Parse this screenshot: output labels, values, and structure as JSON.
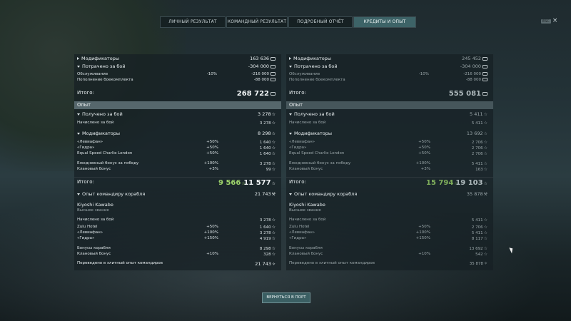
{
  "tabs": [
    "ЛИЧНЫЙ РЕЗУЛЬТАТ",
    "КОМАНДНЫЙ РЕЗУЛЬТАТ",
    "ПОДРОБНЫЙ ОТЧЁТ",
    "КРЕДИТЫ И ОПЫТ"
  ],
  "active_tab": 3,
  "close": {
    "esc_label": "ESC",
    "x": "×"
  },
  "left": {
    "modifiers": {
      "label": "Модификаторы",
      "value": "163 636"
    },
    "spent": {
      "label": "Потрачено за бой",
      "value": "-304 000"
    },
    "service": {
      "label": "Обслуживание",
      "pct": "-10%",
      "value": "-216 000"
    },
    "ammo": {
      "label": "Пополнение боекомплекта",
      "value": "-88 000"
    },
    "total": {
      "label": "Итого:",
      "value": "268 722"
    },
    "xp_section": "Опыт",
    "xp_earned": {
      "label": "Получено за бой",
      "value": "3 278"
    },
    "xp_accrued": {
      "label": "Начислено за бой",
      "value": "3 278"
    },
    "xp_mods": {
      "label": "Модификаторы",
      "value": "8 298"
    },
    "mods": [
      {
        "label": "«Левиафан»",
        "pct": "+50%",
        "value": "1 640"
      },
      {
        "label": "«Гидра»",
        "pct": "+50%",
        "value": "1 640"
      },
      {
        "label": "Equal Speed Charlie London",
        "pct": "+50%",
        "value": "1 640"
      },
      {
        "label": "Ежедневный бонус за победу",
        "pct": "+100%",
        "value": "3 278"
      },
      {
        "label": "Клановый бонус",
        "pct": "+3%",
        "value": "99"
      }
    ],
    "xp_total": {
      "label": "Итого:",
      "green": "9 566",
      "value": "11 577"
    },
    "commander_xp": {
      "label": "Опыт командиру корабля",
      "value": "21 743"
    },
    "commander": {
      "name": "Kiyoshi Kawabe",
      "rank": "Высшее звание"
    },
    "cmd_rows": [
      {
        "label": "Начислено за бой",
        "pct": "",
        "value": "3 278"
      },
      {
        "label": "Zulu Hotel",
        "pct": "+50%",
        "value": "1 640"
      },
      {
        "label": "«Левиафан»",
        "pct": "+100%",
        "value": "3 278"
      },
      {
        "label": "«Гидра»",
        "pct": "+150%",
        "value": "4 919"
      },
      {
        "label": "Бонусы корабля",
        "pct": "",
        "value": "8 298"
      },
      {
        "label": "Клановый бонус",
        "pct": "+10%",
        "value": "328"
      },
      {
        "label": "Переведено в элитный опыт командиров",
        "pct": "",
        "value": "21 743"
      }
    ]
  },
  "right": {
    "modifiers": {
      "label": "Модификаторы",
      "value": "245 452"
    },
    "spent": {
      "label": "Потрачено за бой",
      "value": "-304 000"
    },
    "service": {
      "label": "Обслуживание",
      "pct": "-10%",
      "value": "-216 000"
    },
    "ammo": {
      "label": "Пополнение боекомплекта",
      "value": "-88 000"
    },
    "total": {
      "label": "Итого:",
      "value": "555 081"
    },
    "xp_section": "Опыт",
    "xp_earned": {
      "label": "Получено за бой",
      "value": "5 411"
    },
    "xp_accrued": {
      "label": "Начислено за бой",
      "value": "5 411"
    },
    "xp_mods": {
      "label": "Модификаторы",
      "value": "13 692"
    },
    "mods": [
      {
        "label": "«Левиафан»",
        "pct": "+50%",
        "value": "2 706"
      },
      {
        "label": "«Гидра»",
        "pct": "+50%",
        "value": "2 706"
      },
      {
        "label": "Equal Speed Charlie London",
        "pct": "+50%",
        "value": "2 706"
      },
      {
        "label": "Ежедневный бонус за победу",
        "pct": "+100%",
        "value": "5 411"
      },
      {
        "label": "Клановый бонус",
        "pct": "+3%",
        "value": "163"
      }
    ],
    "xp_total": {
      "label": "Итого:",
      "green": "15 794",
      "value": "19 103"
    },
    "commander_xp": {
      "label": "Опыт командиру корабля",
      "value": "35 878"
    },
    "commander": {
      "name": "Kiyoshi Kawabe",
      "rank": "Высшее звание"
    },
    "cmd_rows": [
      {
        "label": "Начислено за бой",
        "pct": "",
        "value": "5 411"
      },
      {
        "label": "Zulu Hotel",
        "pct": "+50%",
        "value": "2 706"
      },
      {
        "label": "«Левиафан»",
        "pct": "+100%",
        "value": "5 411"
      },
      {
        "label": "«Гидра»",
        "pct": "+150%",
        "value": "8 117"
      },
      {
        "label": "Бонусы корабля",
        "pct": "",
        "value": "13 692"
      },
      {
        "label": "Клановый бонус",
        "pct": "+10%",
        "value": "542"
      },
      {
        "label": "Переведено в элитный опыт командиров",
        "pct": "",
        "value": "35 878"
      }
    ]
  },
  "return_button": "ВЕРНУТЬСЯ В ПОРТ"
}
